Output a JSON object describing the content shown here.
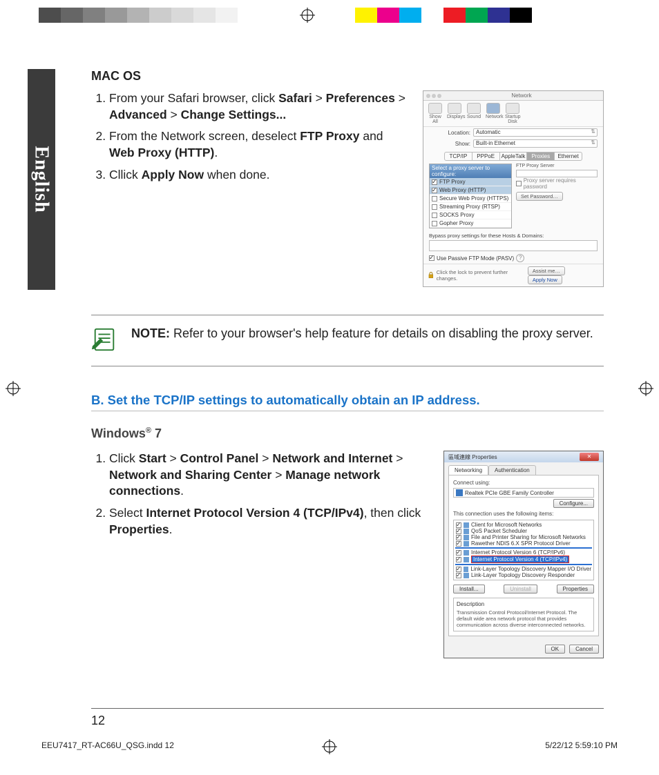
{
  "registration": {
    "grays": [
      "#4d4d4d",
      "#666666",
      "#808080",
      "#999999",
      "#b3b3b3",
      "#cccccc",
      "#d9d9d9",
      "#e5e5e5",
      "#f2f2f2",
      "#ffffff"
    ],
    "colors": [
      "#fff200",
      "#ec008c",
      "#00aeef",
      "#ffffff",
      "#ed1c24",
      "#00a651",
      "#2e3192",
      "#000000"
    ]
  },
  "lang_tab": "English",
  "macos": {
    "heading": "MAC OS",
    "steps": {
      "s1_a": "From your Safari browser, click ",
      "s1_b": "Safari",
      "s1_c": " > ",
      "s1_d": "Preferences",
      "s1_e": " > ",
      "s1_f": "Advanced",
      "s1_g": " > ",
      "s1_h": "Change  Settings...",
      "s2_a": "From the Network screen, deselect ",
      "s2_b": "FTP Proxy",
      "s2_c": " and ",
      "s2_d": "Web Proxy (HTTP)",
      "s2_e": ".",
      "s3_a": "Cllick ",
      "s3_b": "Apply Now",
      "s3_c": " when done."
    },
    "shot": {
      "title": "Network",
      "toolbar": [
        "Show All",
        "Displays",
        "Sound",
        "Network",
        "Startup Disk"
      ],
      "loc_lbl": "Location:",
      "loc_val": "Automatic",
      "show_lbl": "Show:",
      "show_val": "Built-in Ethernet",
      "tabs": [
        "TCP/IP",
        "PPPoE",
        "AppleTalk",
        "Proxies",
        "Ethernet"
      ],
      "list_hdr": "Select a proxy server to configure:",
      "side_hdr": "FTP Proxy Server",
      "proxies": [
        "FTP Proxy",
        "Web Proxy (HTTP)",
        "Secure Web Proxy (HTTPS)",
        "Streaming Proxy (RTSP)",
        "SOCKS Proxy",
        "Gopher Proxy"
      ],
      "req_pw": "Proxy server requires password",
      "set_pw": "Set Password…",
      "bypass_lbl": "Bypass proxy settings for these Hosts & Domains:",
      "pasv": "Use Passive FTP Mode (PASV)",
      "lock_txt": "Click the lock to prevent further changes.",
      "assist": "Assist me…",
      "apply": "Apply Now"
    }
  },
  "note": {
    "label": "NOTE:",
    "text": "   Refer to your browser's help feature for details on disabling the proxy server."
  },
  "section_b": {
    "prefix": "B.",
    "title": "  Set the TCP/IP settings to automatically obtain an IP address."
  },
  "win7": {
    "heading": "Windows® 7",
    "steps": {
      "s1_a": "Click ",
      "s1_b": "Start",
      "s1_c": " > ",
      "s1_d": "Control Panel",
      "s1_e": " > ",
      "s1_f": "Network and Internet",
      "s1_g": " > ",
      "s1_h": "Network and Sharing Center",
      "s1_i": " > ",
      "s1_j": "Manage network connections",
      "s1_k": ".",
      "s2_a": "Select ",
      "s2_b": "Internet Protocol Version 4 (TCP/IPv4)",
      "s2_c": ", then click ",
      "s2_d": "Properties",
      "s2_e": "."
    },
    "shot": {
      "title": "區域連線 Properties",
      "tabs": [
        "Networking",
        "Authentication"
      ],
      "connect_lbl": "Connect using:",
      "adapter": "Realtek PCIe GBE Family Controller",
      "configure": "Configure...",
      "uses_lbl": "This connection uses the following items:",
      "items": [
        "Client for Microsoft Networks",
        "QoS Packet Scheduler",
        "File and Printer Sharing for Microsoft Networks",
        "Rawether NDIS 6.X SPR Protocol Driver",
        "Internet Protocol Version 6 (TCP/IPv6)",
        "Internet Protocol Version 4 (TCP/IPv4)",
        "Link-Layer Topology Discovery Mapper I/O Driver",
        "Link-Layer Topology Discovery Responder"
      ],
      "install": "Install...",
      "uninstall": "Uninstall",
      "properties": "Properties",
      "desc_lbl": "Description",
      "desc": "Transmission Control Protocol/Internet Protocol. The default wide area network protocol that provides communication across diverse interconnected networks.",
      "ok": "OK",
      "cancel": "Cancel"
    }
  },
  "footer": {
    "page": "12",
    "file": "EEU7417_RT-AC66U_QSG.indd   12",
    "stamp": "5/22/12   5:59:10 PM"
  }
}
